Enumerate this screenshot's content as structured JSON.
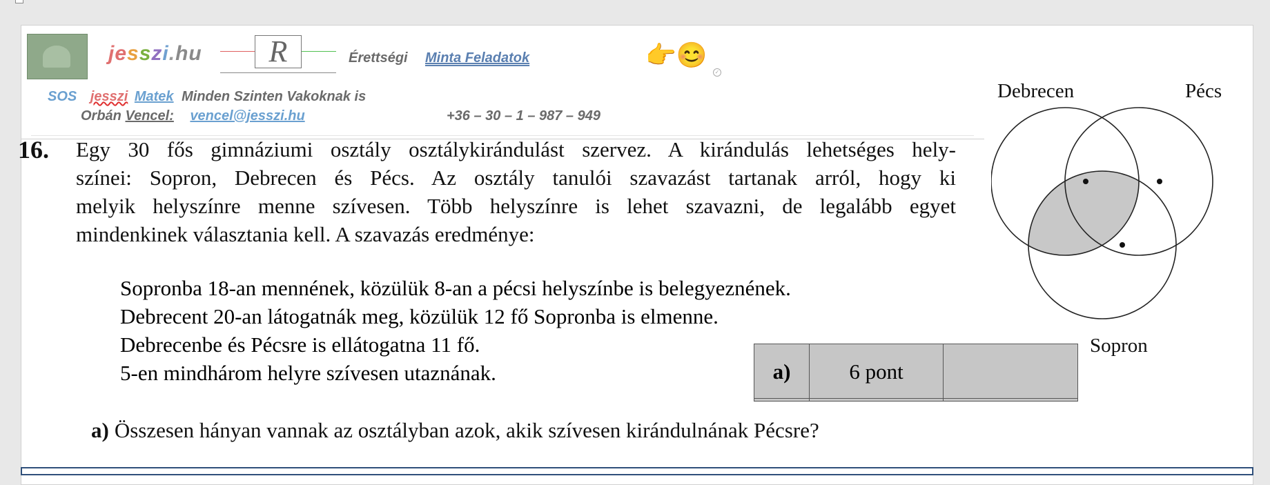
{
  "header": {
    "brand": {
      "j": "j",
      "e": "e",
      "s1": "s",
      "s2": "s",
      "z": "z",
      "i": "i",
      "dot": ".",
      "hu": "hu"
    },
    "r_logo_letter": "R",
    "nav_erettsegi": "Érettségi",
    "nav_minta": "Minta  Feladatok",
    "emoji": "👉😊",
    "sos": "SOS",
    "jesszi": "jesszi",
    "matek": "Matek",
    "minden": "Minden Szinten Vakoknak is",
    "orban": "Orbán",
    "vencel": "Vencel:",
    "email": "vencel@jesszi.hu",
    "phone": "+36 – 30 – 1 – 987 – 949"
  },
  "problem": {
    "number": "16.",
    "intro_lines": [
      "Egy 30 fős gimnáziumi osztály osztálykirándulást szervez. A kirándulás lehetséges hely-",
      "színei: Sopron, Debrecen és Pécs. Az osztály tanulói szavazást tartanak arról, hogy ki",
      "melyik helyszínre menne szívesen. Több helyszínre is lehet szavazni, de legalább egyet",
      "mindenkinek választania kell. A szavazás eredménye:"
    ],
    "items": [
      "Sopronba 18-an mennének, közülük 8-an a pécsi helyszínbe is belegyeznének.",
      "Debrecent 20-an látogatnák meg, közülük 12 fő Sopronba is elmenne.",
      "Debrecenbe és Pécsre is ellátogatna 11 fő.",
      "5-en mindhárom helyre szívesen utaznának."
    ],
    "question_label": "a)",
    "question": "Összesen hányan vannak az osztályban azok, akik szívesen kirándulnának Pécsre?"
  },
  "score_table": {
    "part": "a)",
    "points": "6 pont",
    "blank": ""
  },
  "venn": {
    "labels": [
      "Debrecen",
      "Pécs",
      "Sopron"
    ],
    "shaded_region": "Debrecen ∩ Sopron"
  }
}
